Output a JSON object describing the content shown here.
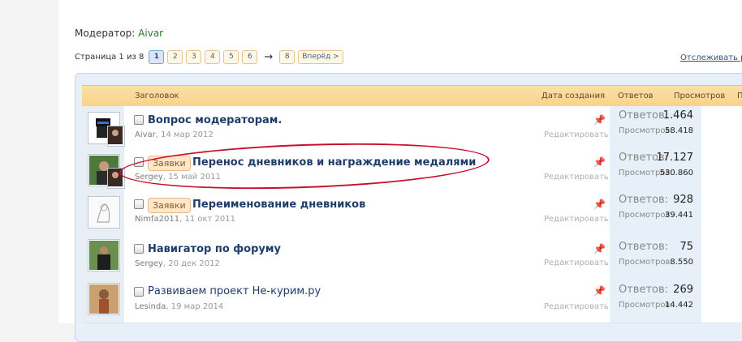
{
  "moderator": {
    "label": "Модератор:",
    "name": "Aivar"
  },
  "pagination": {
    "label": "Страница 1 из 8",
    "pages": [
      "1",
      "2",
      "3",
      "4",
      "5",
      "6"
    ],
    "arrow": "→",
    "last": "8",
    "next": "Вперёд >"
  },
  "watch_link": "Отслеживать р",
  "headers": {
    "title": "Заголовок",
    "created": "Дата создания",
    "replies": "Ответов",
    "views": "Просмотров",
    "last": "П"
  },
  "threads": [
    {
      "prefix": "",
      "title": "Вопрос модераторам.",
      "author": "Aivar",
      "date": "14 мар 2012",
      "edit": "Редактировать",
      "replies_label": "Ответов:",
      "replies": "1.464",
      "views_label": "Просмотров:",
      "views": "58.418"
    },
    {
      "prefix": "Заявки",
      "title": "Перенос дневников и награждение медалями",
      "author": "Sergey",
      "date": "15 май 2011",
      "edit": "Редактировать",
      "replies_label": "Ответов:",
      "replies": "17.127",
      "views_label": "Просмотров:",
      "views": "530.860"
    },
    {
      "prefix": "Заявки",
      "title": "Переименование дневников",
      "author": "Nimfa2011",
      "date": "11 окт 2011",
      "edit": "Редактировать",
      "replies_label": "Ответов:",
      "replies": "928",
      "views_label": "Просмотров:",
      "views": "39.441"
    },
    {
      "prefix": "",
      "title": "Навигатор по форуму",
      "author": "Sergey",
      "date": "20 дек 2012",
      "edit": "Редактировать",
      "replies_label": "Ответов:",
      "replies": "75",
      "views_label": "Просмотров:",
      "views": "8.550"
    },
    {
      "prefix": "",
      "title": "Развиваем проект Не-курим.ру",
      "author": "Lesinda",
      "date": "19 мар 2014",
      "edit": "Редактировать",
      "replies_label": "Ответов:",
      "replies": "269",
      "views_label": "Просмотров:",
      "views": "14.442"
    }
  ],
  "colors": {
    "accent": "#1f3d6a",
    "header_bg": "#f9d288",
    "highlight_oval": "#c8102e",
    "moderator_name": "#2c7a2c"
  },
  "icons": {
    "pin": "pin-icon",
    "checkbox": "checkbox-icon"
  }
}
